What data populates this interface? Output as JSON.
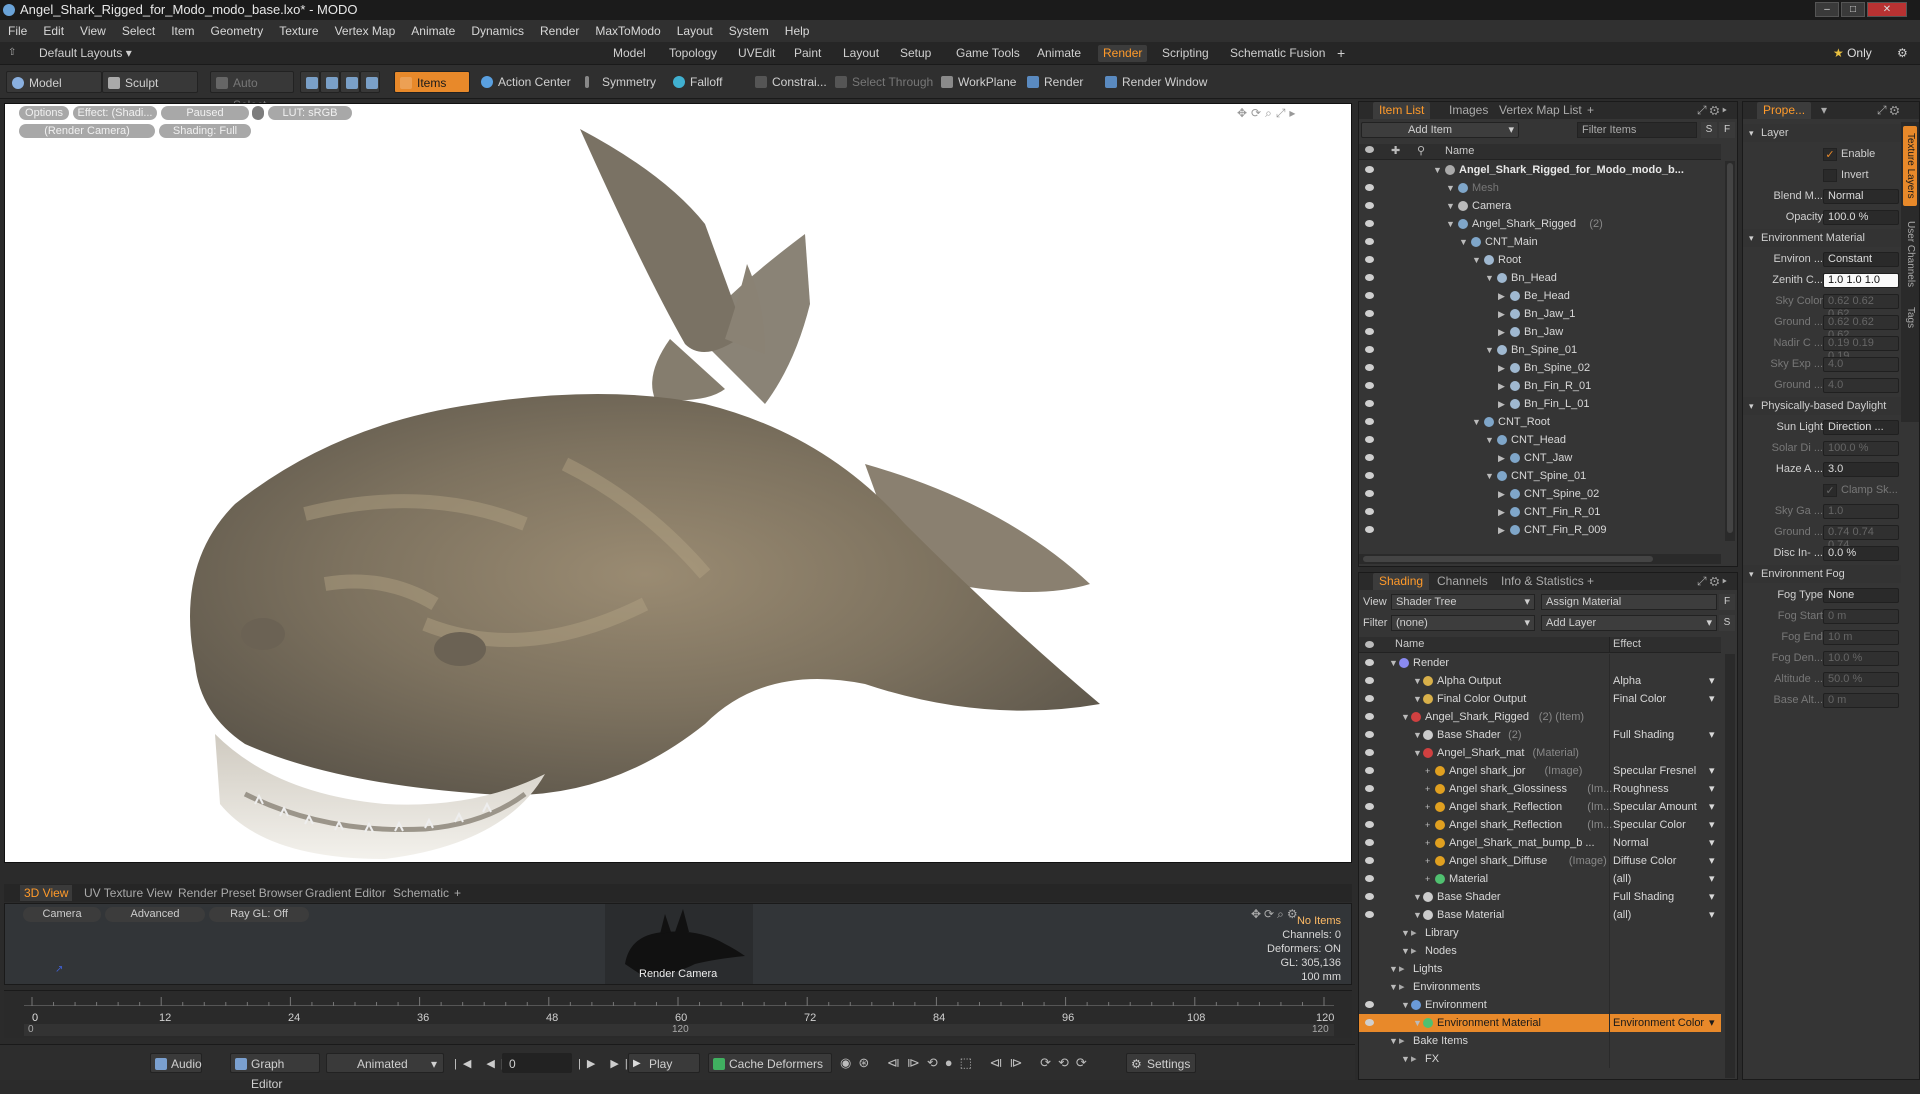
{
  "window": {
    "title": "Angel_Shark_Rigged_for_Modo_modo_base.lxo* - MODO"
  },
  "menu": [
    "File",
    "Edit",
    "View",
    "Select",
    "Item",
    "Geometry",
    "Texture",
    "Vertex Map",
    "Animate",
    "Dynamics",
    "Render",
    "MaxToModo",
    "Layout",
    "System",
    "Help"
  ],
  "layouts": {
    "default": "Default Layouts",
    "tabs": [
      "Model",
      "Topology",
      "UVEdit",
      "Paint",
      "Layout",
      "Setup",
      "Game Tools",
      "Animate",
      "Render",
      "Scripting",
      "Schematic Fusion"
    ],
    "active": "Render",
    "only": "Only"
  },
  "toolbar": {
    "model": "Model",
    "sculpt": "Sculpt",
    "auto_select": "Auto Select",
    "items": "Items",
    "action_center": "Action Center",
    "symmetry": "Symmetry",
    "falloff": "Falloff",
    "constraint": "Constrai...",
    "select_through": "Select Through",
    "workplane": "WorkPlane",
    "render": "Render",
    "render_window": "Render Window"
  },
  "viewport": {
    "options": "Options",
    "effect": "Effect: (Shadi...",
    "paused": "Paused",
    "lut": "LUT: sRGB",
    "camera": "(Render Camera)",
    "shading": "Shading: Full"
  },
  "viewtabs": [
    "3D View",
    "UV Texture View",
    "Render Preset Browser",
    "Gradient Editor",
    "Schematic"
  ],
  "view3d": {
    "camera": "Camera",
    "advanced": "Advanced",
    "raygl": "Ray GL: Off",
    "render_camera": "Render Camera",
    "stats": [
      "No Items",
      "Channels: 0",
      "Deformers: ON",
      "GL: 305,136",
      "100 mm"
    ]
  },
  "timeline": {
    "ticks": [
      "0",
      "12",
      "24",
      "36",
      "48",
      "60",
      "72",
      "84",
      "96",
      "108",
      "120"
    ],
    "sub": [
      "0",
      "120",
      "120"
    ]
  },
  "bottom": {
    "audio": "Audio",
    "graph_editor": "Graph Editor",
    "animated": "Animated",
    "frame": "0",
    "play": "Play",
    "cache": "Cache Deformers",
    "settings": "Settings"
  },
  "itemlist": {
    "tabs": [
      "Item List",
      "Images",
      "Vertex Map List"
    ],
    "add_item": "Add Item",
    "filter": "Filter Items",
    "s": "S",
    "f": "F",
    "col": "Name",
    "rows": [
      {
        "label": "Angel_Shark_Rigged_for_Modo_modo_b...",
        "indent": 0,
        "bold": true,
        "color": "#aaa"
      },
      {
        "label": "Mesh",
        "indent": 1,
        "dim": true,
        "color": "#7fa6c9"
      },
      {
        "label": "Camera",
        "indent": 1,
        "color": "#bbb"
      },
      {
        "label": "Angel_Shark_Rigged",
        "sub": "(2)",
        "indent": 1,
        "color": "#7fa6c9"
      },
      {
        "label": "CNT_Main",
        "indent": 2,
        "color": "#7fa6c9"
      },
      {
        "label": "Root",
        "indent": 3,
        "color": "#9fb8d0"
      },
      {
        "label": "Bn_Head",
        "indent": 4,
        "color": "#9fb8d0"
      },
      {
        "label": "Be_Head",
        "indent": 5,
        "color": "#9fb8d0"
      },
      {
        "label": "Bn_Jaw_1",
        "indent": 5,
        "color": "#9fb8d0"
      },
      {
        "label": "Bn_Jaw",
        "indent": 5,
        "color": "#9fb8d0"
      },
      {
        "label": "Bn_Spine_01",
        "indent": 4,
        "color": "#9fb8d0"
      },
      {
        "label": "Bn_Spine_02",
        "indent": 5,
        "color": "#9fb8d0"
      },
      {
        "label": "Bn_Fin_R_01",
        "indent": 5,
        "color": "#9fb8d0"
      },
      {
        "label": "Bn_Fin_L_01",
        "indent": 5,
        "color": "#9fb8d0"
      },
      {
        "label": "CNT_Root",
        "indent": 3,
        "color": "#7fa6c9"
      },
      {
        "label": "CNT_Head",
        "indent": 4,
        "color": "#7fa6c9"
      },
      {
        "label": "CNT_Jaw",
        "indent": 5,
        "color": "#7fa6c9"
      },
      {
        "label": "CNT_Spine_01",
        "indent": 4,
        "color": "#7fa6c9"
      },
      {
        "label": "CNT_Spine_02",
        "indent": 5,
        "color": "#7fa6c9"
      },
      {
        "label": "CNT_Fin_R_01",
        "indent": 5,
        "color": "#7fa6c9"
      },
      {
        "label": "CNT_Fin_R_009",
        "indent": 5,
        "color": "#7fa6c9"
      }
    ]
  },
  "shading": {
    "tabs": [
      "Shading",
      "Channels",
      "Info & Statistics"
    ],
    "view_label": "View",
    "view_value": "Shader Tree",
    "assign": "Assign Material",
    "filter_label": "Filter",
    "filter_value": "(none)",
    "add_layer": "Add Layer",
    "col_name": "Name",
    "col_effect": "Effect",
    "rows": [
      {
        "label": "Render",
        "indent": 0,
        "color": "#8a8af0",
        "effect": ""
      },
      {
        "label": "Alpha Output",
        "indent": 2,
        "color": "#d8b04a",
        "effect": "Alpha"
      },
      {
        "label": "Final Color Output",
        "indent": 2,
        "color": "#d8b04a",
        "effect": "Final Color"
      },
      {
        "label": "Angel_Shark_Rigged",
        "sub": "(2) (Item)",
        "indent": 1,
        "color": "#d04040",
        "effect": ""
      },
      {
        "label": "Base Shader",
        "sub": "(2)",
        "indent": 2,
        "color": "#cccccc",
        "effect": "Full Shading"
      },
      {
        "label": "Angel_Shark_mat",
        "sub": "(Material)",
        "indent": 2,
        "color": "#d04040",
        "effect": ""
      },
      {
        "label": "Angel shark_jor",
        "sub": "(Image)",
        "indent": 3,
        "color": "#e0a020",
        "effect": "Specular Fresnel"
      },
      {
        "label": "Angel shark_Glossiness",
        "sub": "(Im...",
        "indent": 3,
        "color": "#e0a020",
        "effect": "Roughness"
      },
      {
        "label": "Angel shark_Reflection",
        "sub": "(Im...",
        "indent": 3,
        "color": "#e0a020",
        "effect": "Specular Amount"
      },
      {
        "label": "Angel shark_Reflection",
        "sub": "(Im...",
        "indent": 3,
        "color": "#e0a020",
        "effect": "Specular Color"
      },
      {
        "label": "Angel_Shark_mat_bump_b ...",
        "indent": 3,
        "color": "#e0a020",
        "effect": "Normal"
      },
      {
        "label": "Angel shark_Diffuse",
        "sub": "(Image)",
        "indent": 3,
        "color": "#e0a020",
        "effect": "Diffuse Color"
      },
      {
        "label": "Material",
        "indent": 3,
        "color": "#50c070",
        "effect": "(all)"
      },
      {
        "label": "Base Shader",
        "indent": 2,
        "color": "#cccccc",
        "effect": "Full Shading"
      },
      {
        "label": "Base Material",
        "indent": 2,
        "color": "#cccccc",
        "effect": "(all)"
      },
      {
        "label": "Library",
        "indent": 1,
        "color": "",
        "effect": ""
      },
      {
        "label": "Nodes",
        "indent": 1,
        "color": "",
        "effect": ""
      },
      {
        "label": "Lights",
        "indent": 0,
        "color": "",
        "effect": ""
      },
      {
        "label": "Environments",
        "indent": 0,
        "color": "",
        "effect": ""
      },
      {
        "label": "Environment",
        "indent": 1,
        "color": "#6a9ad8",
        "effect": ""
      },
      {
        "label": "Environment Material",
        "indent": 2,
        "color": "#50c070",
        "effect": "Environment Color",
        "selected": true
      },
      {
        "label": "Bake Items",
        "indent": 0,
        "color": "",
        "effect": ""
      },
      {
        "label": "FX",
        "indent": 1,
        "color": "",
        "effect": ""
      }
    ]
  },
  "properties": {
    "tab": "Prope...",
    "side_tabs": [
      "Texture Layers",
      "User Channels",
      "Tags"
    ],
    "rows": [
      {
        "type": "sect",
        "label": "Layer"
      },
      {
        "type": "check",
        "label": "Enable",
        "checked": true
      },
      {
        "type": "check",
        "label": "Invert",
        "checked": false
      },
      {
        "type": "field",
        "label": "Blend M...",
        "value": "Normal"
      },
      {
        "type": "field",
        "label": "Opacity",
        "value": "100.0 %"
      },
      {
        "type": "sect",
        "label": "Environment Material"
      },
      {
        "type": "field",
        "label": "Environ ...",
        "value": "Constant"
      },
      {
        "type": "field",
        "label": "Zenith C...",
        "value": "1.0  1.0  1.0",
        "white": true
      },
      {
        "type": "field",
        "label": "Sky Color",
        "value": "0.62  0.62  0.62",
        "dim": true
      },
      {
        "type": "field",
        "label": "Ground ...",
        "value": "0.62  0.62  0.62",
        "dim": true
      },
      {
        "type": "field",
        "label": "Nadir C ...",
        "value": "0.19  0.19  0.19",
        "dim": true
      },
      {
        "type": "field",
        "label": "Sky Exp ...",
        "value": "4.0",
        "dim": true
      },
      {
        "type": "field",
        "label": "Ground ...",
        "value": "4.0",
        "dim": true
      },
      {
        "type": "sect",
        "label": "Physically-based Daylight"
      },
      {
        "type": "field",
        "label": "Sun Light",
        "value": "Direction ..."
      },
      {
        "type": "field",
        "label": "Solar Di ...",
        "value": "100.0 %",
        "dim": true
      },
      {
        "type": "field",
        "label": "Haze A ...",
        "value": "3.0"
      },
      {
        "type": "check",
        "label": "Clamp Sk...",
        "checked": true,
        "dim": true
      },
      {
        "type": "field",
        "label": "Sky Ga ...",
        "value": "1.0",
        "dim": true
      },
      {
        "type": "field",
        "label": "Ground ...",
        "value": "0.74  0.74  0.74",
        "dim": true
      },
      {
        "type": "field",
        "label": "Disc In- ...",
        "value": "0.0 %"
      },
      {
        "type": "sect",
        "label": "Environment Fog"
      },
      {
        "type": "field",
        "label": "Fog Type",
        "value": "None"
      },
      {
        "type": "field",
        "label": "Fog Start",
        "value": "0 m",
        "dim": true
      },
      {
        "type": "field",
        "label": "Fog End",
        "value": "10 m",
        "dim": true
      },
      {
        "type": "field",
        "label": "Fog Den...",
        "value": "10.0 %",
        "dim": true
      },
      {
        "type": "field",
        "label": "Altitude ...",
        "value": "50.0 %",
        "dim": true
      },
      {
        "type": "field",
        "label": "Base Alt...",
        "value": "0 m",
        "dim": true
      }
    ]
  }
}
